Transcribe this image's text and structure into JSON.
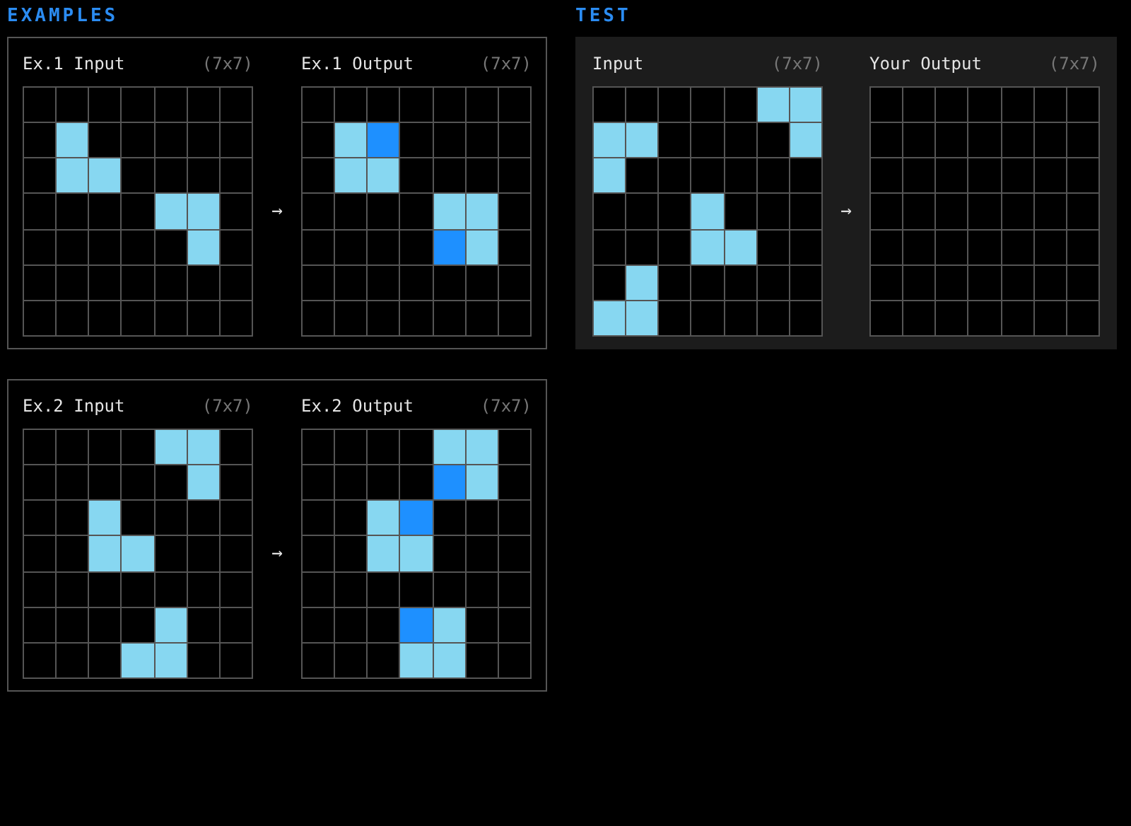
{
  "examples": {
    "heading": "EXAMPLES",
    "pairs": [
      {
        "input": {
          "label": "Ex.1 Input",
          "size": "(7x7)",
          "rows": [
            [
              {
                "color": "#000000"
              },
              {
                "color": "#000000"
              },
              {
                "color": "#000000"
              },
              {
                "color": "#000000"
              },
              {
                "color": "#000000"
              },
              {
                "color": "#000000"
              },
              {
                "color": "#000000"
              }
            ],
            [
              {
                "color": "#000000"
              },
              {
                "color": "#87d7f1"
              },
              {
                "color": "#000000"
              },
              {
                "color": "#000000"
              },
              {
                "color": "#000000"
              },
              {
                "color": "#000000"
              },
              {
                "color": "#000000"
              }
            ],
            [
              {
                "color": "#000000"
              },
              {
                "color": "#87d7f1"
              },
              {
                "color": "#87d7f1"
              },
              {
                "color": "#000000"
              },
              {
                "color": "#000000"
              },
              {
                "color": "#000000"
              },
              {
                "color": "#000000"
              }
            ],
            [
              {
                "color": "#000000"
              },
              {
                "color": "#000000"
              },
              {
                "color": "#000000"
              },
              {
                "color": "#000000"
              },
              {
                "color": "#87d7f1"
              },
              {
                "color": "#87d7f1"
              },
              {
                "color": "#000000"
              }
            ],
            [
              {
                "color": "#000000"
              },
              {
                "color": "#000000"
              },
              {
                "color": "#000000"
              },
              {
                "color": "#000000"
              },
              {
                "color": "#000000"
              },
              {
                "color": "#87d7f1"
              },
              {
                "color": "#000000"
              }
            ],
            [
              {
                "color": "#000000"
              },
              {
                "color": "#000000"
              },
              {
                "color": "#000000"
              },
              {
                "color": "#000000"
              },
              {
                "color": "#000000"
              },
              {
                "color": "#000000"
              },
              {
                "color": "#000000"
              }
            ],
            [
              {
                "color": "#000000"
              },
              {
                "color": "#000000"
              },
              {
                "color": "#000000"
              },
              {
                "color": "#000000"
              },
              {
                "color": "#000000"
              },
              {
                "color": "#000000"
              },
              {
                "color": "#000000"
              }
            ]
          ]
        },
        "arrow": "→",
        "output": {
          "label": "Ex.1 Output",
          "size": "(7x7)",
          "rows": [
            [
              {
                "color": "#000000"
              },
              {
                "color": "#000000"
              },
              {
                "color": "#000000"
              },
              {
                "color": "#000000"
              },
              {
                "color": "#000000"
              },
              {
                "color": "#000000"
              },
              {
                "color": "#000000"
              }
            ],
            [
              {
                "color": "#000000"
              },
              {
                "color": "#87d7f1"
              },
              {
                "color": "#1e90ff"
              },
              {
                "color": "#000000"
              },
              {
                "color": "#000000"
              },
              {
                "color": "#000000"
              },
              {
                "color": "#000000"
              }
            ],
            [
              {
                "color": "#000000"
              },
              {
                "color": "#87d7f1"
              },
              {
                "color": "#87d7f1"
              },
              {
                "color": "#000000"
              },
              {
                "color": "#000000"
              },
              {
                "color": "#000000"
              },
              {
                "color": "#000000"
              }
            ],
            [
              {
                "color": "#000000"
              },
              {
                "color": "#000000"
              },
              {
                "color": "#000000"
              },
              {
                "color": "#000000"
              },
              {
                "color": "#87d7f1"
              },
              {
                "color": "#87d7f1"
              },
              {
                "color": "#000000"
              }
            ],
            [
              {
                "color": "#000000"
              },
              {
                "color": "#000000"
              },
              {
                "color": "#000000"
              },
              {
                "color": "#000000"
              },
              {
                "color": "#1e90ff"
              },
              {
                "color": "#87d7f1"
              },
              {
                "color": "#000000"
              }
            ],
            [
              {
                "color": "#000000"
              },
              {
                "color": "#000000"
              },
              {
                "color": "#000000"
              },
              {
                "color": "#000000"
              },
              {
                "color": "#000000"
              },
              {
                "color": "#000000"
              },
              {
                "color": "#000000"
              }
            ],
            [
              {
                "color": "#000000"
              },
              {
                "color": "#000000"
              },
              {
                "color": "#000000"
              },
              {
                "color": "#000000"
              },
              {
                "color": "#000000"
              },
              {
                "color": "#000000"
              },
              {
                "color": "#000000"
              }
            ]
          ]
        }
      },
      {
        "input": {
          "label": "Ex.2 Input",
          "size": "(7x7)",
          "rows": [
            [
              {
                "color": "#000000"
              },
              {
                "color": "#000000"
              },
              {
                "color": "#000000"
              },
              {
                "color": "#000000"
              },
              {
                "color": "#87d7f1"
              },
              {
                "color": "#87d7f1"
              },
              {
                "color": "#000000"
              }
            ],
            [
              {
                "color": "#000000"
              },
              {
                "color": "#000000"
              },
              {
                "color": "#000000"
              },
              {
                "color": "#000000"
              },
              {
                "color": "#000000"
              },
              {
                "color": "#87d7f1"
              },
              {
                "color": "#000000"
              }
            ],
            [
              {
                "color": "#000000"
              },
              {
                "color": "#000000"
              },
              {
                "color": "#87d7f1"
              },
              {
                "color": "#000000"
              },
              {
                "color": "#000000"
              },
              {
                "color": "#000000"
              },
              {
                "color": "#000000"
              }
            ],
            [
              {
                "color": "#000000"
              },
              {
                "color": "#000000"
              },
              {
                "color": "#87d7f1"
              },
              {
                "color": "#87d7f1"
              },
              {
                "color": "#000000"
              },
              {
                "color": "#000000"
              },
              {
                "color": "#000000"
              }
            ],
            [
              {
                "color": "#000000"
              },
              {
                "color": "#000000"
              },
              {
                "color": "#000000"
              },
              {
                "color": "#000000"
              },
              {
                "color": "#000000"
              },
              {
                "color": "#000000"
              },
              {
                "color": "#000000"
              }
            ],
            [
              {
                "color": "#000000"
              },
              {
                "color": "#000000"
              },
              {
                "color": "#000000"
              },
              {
                "color": "#000000"
              },
              {
                "color": "#87d7f1"
              },
              {
                "color": "#000000"
              },
              {
                "color": "#000000"
              }
            ],
            [
              {
                "color": "#000000"
              },
              {
                "color": "#000000"
              },
              {
                "color": "#000000"
              },
              {
                "color": "#87d7f1"
              },
              {
                "color": "#87d7f1"
              },
              {
                "color": "#000000"
              },
              {
                "color": "#000000"
              }
            ]
          ]
        },
        "arrow": "→",
        "output": {
          "label": "Ex.2 Output",
          "size": "(7x7)",
          "rows": [
            [
              {
                "color": "#000000"
              },
              {
                "color": "#000000"
              },
              {
                "color": "#000000"
              },
              {
                "color": "#000000"
              },
              {
                "color": "#87d7f1"
              },
              {
                "color": "#87d7f1"
              },
              {
                "color": "#000000"
              }
            ],
            [
              {
                "color": "#000000"
              },
              {
                "color": "#000000"
              },
              {
                "color": "#000000"
              },
              {
                "color": "#000000"
              },
              {
                "color": "#1e90ff"
              },
              {
                "color": "#87d7f1"
              },
              {
                "color": "#000000"
              }
            ],
            [
              {
                "color": "#000000"
              },
              {
                "color": "#000000"
              },
              {
                "color": "#87d7f1"
              },
              {
                "color": "#1e90ff"
              },
              {
                "color": "#000000"
              },
              {
                "color": "#000000"
              },
              {
                "color": "#000000"
              }
            ],
            [
              {
                "color": "#000000"
              },
              {
                "color": "#000000"
              },
              {
                "color": "#87d7f1"
              },
              {
                "color": "#87d7f1"
              },
              {
                "color": "#000000"
              },
              {
                "color": "#000000"
              },
              {
                "color": "#000000"
              }
            ],
            [
              {
                "color": "#000000"
              },
              {
                "color": "#000000"
              },
              {
                "color": "#000000"
              },
              {
                "color": "#000000"
              },
              {
                "color": "#000000"
              },
              {
                "color": "#000000"
              },
              {
                "color": "#000000"
              }
            ],
            [
              {
                "color": "#000000"
              },
              {
                "color": "#000000"
              },
              {
                "color": "#000000"
              },
              {
                "color": "#1e90ff"
              },
              {
                "color": "#87d7f1"
              },
              {
                "color": "#000000"
              },
              {
                "color": "#000000"
              }
            ],
            [
              {
                "color": "#000000"
              },
              {
                "color": "#000000"
              },
              {
                "color": "#000000"
              },
              {
                "color": "#87d7f1"
              },
              {
                "color": "#87d7f1"
              },
              {
                "color": "#000000"
              },
              {
                "color": "#000000"
              }
            ]
          ]
        }
      }
    ]
  },
  "test": {
    "heading": "TEST",
    "input": {
      "label": "Input",
      "size": "(7x7)",
      "rows": [
        [
          {
            "color": "#000000"
          },
          {
            "color": "#000000"
          },
          {
            "color": "#000000"
          },
          {
            "color": "#000000"
          },
          {
            "color": "#000000"
          },
          {
            "color": "#87d7f1"
          },
          {
            "color": "#87d7f1"
          }
        ],
        [
          {
            "color": "#87d7f1"
          },
          {
            "color": "#87d7f1"
          },
          {
            "color": "#000000"
          },
          {
            "color": "#000000"
          },
          {
            "color": "#000000"
          },
          {
            "color": "#000000"
          },
          {
            "color": "#87d7f1"
          }
        ],
        [
          {
            "color": "#87d7f1"
          },
          {
            "color": "#000000"
          },
          {
            "color": "#000000"
          },
          {
            "color": "#000000"
          },
          {
            "color": "#000000"
          },
          {
            "color": "#000000"
          },
          {
            "color": "#000000"
          }
        ],
        [
          {
            "color": "#000000"
          },
          {
            "color": "#000000"
          },
          {
            "color": "#000000"
          },
          {
            "color": "#87d7f1"
          },
          {
            "color": "#000000"
          },
          {
            "color": "#000000"
          },
          {
            "color": "#000000"
          }
        ],
        [
          {
            "color": "#000000"
          },
          {
            "color": "#000000"
          },
          {
            "color": "#000000"
          },
          {
            "color": "#87d7f1"
          },
          {
            "color": "#87d7f1"
          },
          {
            "color": "#000000"
          },
          {
            "color": "#000000"
          }
        ],
        [
          {
            "color": "#000000"
          },
          {
            "color": "#87d7f1"
          },
          {
            "color": "#000000"
          },
          {
            "color": "#000000"
          },
          {
            "color": "#000000"
          },
          {
            "color": "#000000"
          },
          {
            "color": "#000000"
          }
        ],
        [
          {
            "color": "#87d7f1"
          },
          {
            "color": "#87d7f1"
          },
          {
            "color": "#000000"
          },
          {
            "color": "#000000"
          },
          {
            "color": "#000000"
          },
          {
            "color": "#000000"
          },
          {
            "color": "#000000"
          }
        ]
      ]
    },
    "arrow": "→",
    "output": {
      "label": "Your Output",
      "size": "(7x7)",
      "rows": [
        [
          {
            "color": "#000000"
          },
          {
            "color": "#000000"
          },
          {
            "color": "#000000"
          },
          {
            "color": "#000000"
          },
          {
            "color": "#000000"
          },
          {
            "color": "#000000"
          },
          {
            "color": "#000000"
          }
        ],
        [
          {
            "color": "#000000"
          },
          {
            "color": "#000000"
          },
          {
            "color": "#000000"
          },
          {
            "color": "#000000"
          },
          {
            "color": "#000000"
          },
          {
            "color": "#000000"
          },
          {
            "color": "#000000"
          }
        ],
        [
          {
            "color": "#000000"
          },
          {
            "color": "#000000"
          },
          {
            "color": "#000000"
          },
          {
            "color": "#000000"
          },
          {
            "color": "#000000"
          },
          {
            "color": "#000000"
          },
          {
            "color": "#000000"
          }
        ],
        [
          {
            "color": "#000000"
          },
          {
            "color": "#000000"
          },
          {
            "color": "#000000"
          },
          {
            "color": "#000000"
          },
          {
            "color": "#000000"
          },
          {
            "color": "#000000"
          },
          {
            "color": "#000000"
          }
        ],
        [
          {
            "color": "#000000"
          },
          {
            "color": "#000000"
          },
          {
            "color": "#000000"
          },
          {
            "color": "#000000"
          },
          {
            "color": "#000000"
          },
          {
            "color": "#000000"
          },
          {
            "color": "#000000"
          }
        ],
        [
          {
            "color": "#000000"
          },
          {
            "color": "#000000"
          },
          {
            "color": "#000000"
          },
          {
            "color": "#000000"
          },
          {
            "color": "#000000"
          },
          {
            "color": "#000000"
          },
          {
            "color": "#000000"
          }
        ],
        [
          {
            "color": "#000000"
          },
          {
            "color": "#000000"
          },
          {
            "color": "#000000"
          },
          {
            "color": "#000000"
          },
          {
            "color": "#000000"
          },
          {
            "color": "#000000"
          },
          {
            "color": "#000000"
          }
        ]
      ]
    }
  }
}
